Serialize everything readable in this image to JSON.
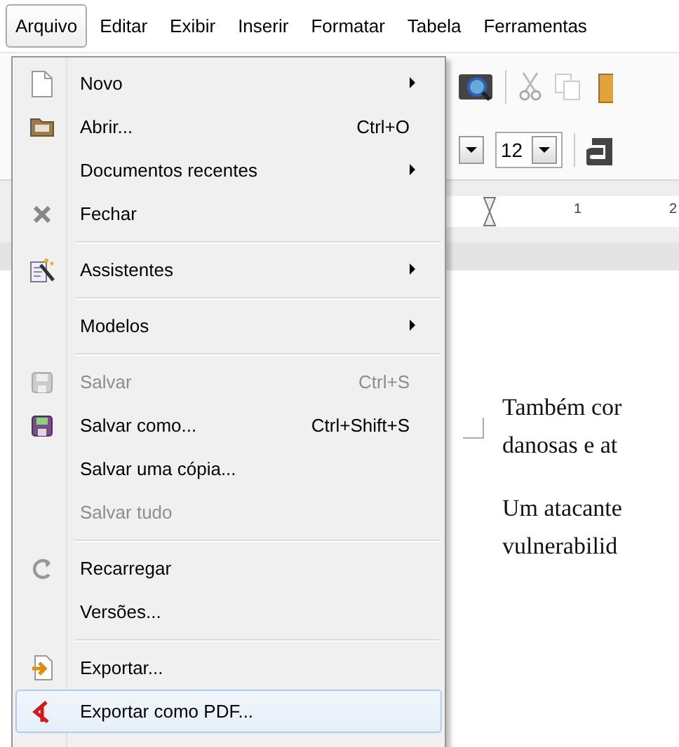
{
  "menubar": [
    {
      "label": "Arquivo",
      "selected": true
    },
    {
      "label": "Editar",
      "selected": false
    },
    {
      "label": "Exibir",
      "selected": false
    },
    {
      "label": "Inserir",
      "selected": false
    },
    {
      "label": "Formatar",
      "selected": false
    },
    {
      "label": "Tabela",
      "selected": false
    },
    {
      "label": "Ferramentas",
      "selected": false
    }
  ],
  "menu": {
    "items": [
      {
        "kind": "item",
        "label": "Novo",
        "submenu": true,
        "disabled": false,
        "selected": false
      },
      {
        "kind": "item",
        "label": "Abrir...",
        "shortcut": "Ctrl+O",
        "submenu": false,
        "disabled": false,
        "selected": false
      },
      {
        "kind": "item",
        "label": "Documentos recentes",
        "submenu": true,
        "disabled": false,
        "selected": false
      },
      {
        "kind": "item",
        "label": "Fechar",
        "submenu": false,
        "disabled": false,
        "selected": false
      },
      {
        "kind": "separator"
      },
      {
        "kind": "item",
        "label": "Assistentes",
        "submenu": true,
        "disabled": false,
        "selected": false
      },
      {
        "kind": "separator"
      },
      {
        "kind": "item",
        "label": "Modelos",
        "submenu": true,
        "disabled": false,
        "selected": false
      },
      {
        "kind": "separator"
      },
      {
        "kind": "item",
        "label": "Salvar",
        "shortcut": "Ctrl+S",
        "submenu": false,
        "disabled": true,
        "selected": false
      },
      {
        "kind": "item",
        "label": "Salvar como...",
        "shortcut": "Ctrl+Shift+S",
        "submenu": false,
        "disabled": false,
        "selected": false
      },
      {
        "kind": "item",
        "label": "Salvar uma cópia...",
        "submenu": false,
        "disabled": false,
        "selected": false
      },
      {
        "kind": "item",
        "label": "Salvar tudo",
        "submenu": false,
        "disabled": true,
        "selected": false
      },
      {
        "kind": "separator"
      },
      {
        "kind": "item",
        "label": "Recarregar",
        "submenu": false,
        "disabled": false,
        "selected": false
      },
      {
        "kind": "item",
        "label": "Versões...",
        "submenu": false,
        "disabled": false,
        "selected": false
      },
      {
        "kind": "separator"
      },
      {
        "kind": "item",
        "label": "Exportar...",
        "submenu": false,
        "disabled": false,
        "selected": false
      },
      {
        "kind": "item",
        "label": "Exportar como PDF...",
        "submenu": false,
        "disabled": false,
        "selected": true
      }
    ]
  },
  "toolbar": {
    "font_size": "12"
  },
  "ruler": {
    "labels": [
      "1",
      "2"
    ]
  },
  "document": {
    "paragraphs": [
      [
        "Também cor",
        "danosas e at"
      ],
      [
        "Um atacante",
        "vulnerabilid"
      ]
    ]
  }
}
